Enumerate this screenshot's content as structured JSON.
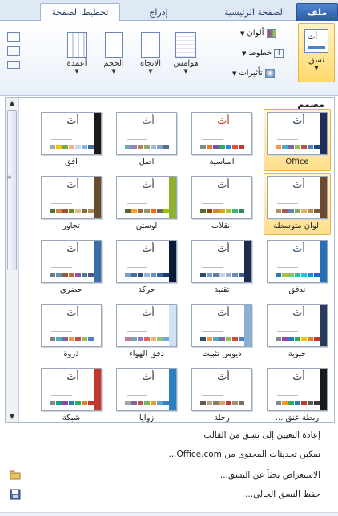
{
  "tabs": {
    "file": "ملف",
    "home": "الصفحة الرئيسية",
    "insert": "إدراج",
    "page_layout": "تخطيط الصفحة"
  },
  "ribbon": {
    "themes_label": "نسق",
    "colors_label": "ألوان",
    "fonts_label": "خطوط",
    "effects_label": "تأثيرات",
    "margins_label": "هوامش",
    "orientation_label": "الاتجاه",
    "size_label": "الحجم",
    "columns_label": "أعمدة"
  },
  "gallery": {
    "heading": "مصمم",
    "themes": [
      {
        "label": "Office",
        "accent": "#1f2f5a",
        "title_color": "#1f2f5a",
        "selected": true,
        "swatches": [
          "#1f497d",
          "#4f81bd",
          "#c0504d",
          "#9bbb59",
          "#8064a2",
          "#4bacc6",
          "#f79646"
        ]
      },
      {
        "label": "أساسية",
        "accent": "#ffffff",
        "title_color": "#c0392b",
        "selected": false,
        "swatches": [
          "#c0392b",
          "#e74c3c",
          "#2e86de",
          "#27ae60",
          "#8e44ad",
          "#e67e22",
          "#7f8c8d"
        ]
      },
      {
        "label": "أصل",
        "accent": "#ffffff",
        "title_color": "#555555",
        "selected": false,
        "swatches": [
          "#5b6c8f",
          "#7f9fcf",
          "#a0b8d8",
          "#8faa72",
          "#b48a5c",
          "#9c7fb8",
          "#6aa9b6"
        ]
      },
      {
        "label": "أفق",
        "accent": "#1a1a1a",
        "title_color": "#333333",
        "selected": false,
        "swatches": [
          "#3a6ea5",
          "#8fb0d6",
          "#c6d9ef",
          "#f4b183",
          "#70ad47",
          "#ffc000",
          "#a5a5a5"
        ]
      },
      {
        "label": "ألوان متوسطة",
        "accent": "#6b4a2f",
        "title_color": "#444444",
        "selected": true,
        "swatches": [
          "#7a5c3f",
          "#c08a4a",
          "#d9b36b",
          "#8aa65b",
          "#5f8aa6",
          "#a05a5a",
          "#b58d5f"
        ]
      },
      {
        "label": "انقلاب",
        "accent": "#ffffff",
        "title_color": "#444444",
        "selected": false,
        "swatches": [
          "#2e8b57",
          "#3cb371",
          "#9acd32",
          "#daa520",
          "#cd853f",
          "#8b4513",
          "#556b2f"
        ]
      },
      {
        "label": "أوستن",
        "accent": "#8fb030",
        "title_color": "#444444",
        "selected": false,
        "swatches": [
          "#94c600",
          "#71685a",
          "#ff6700",
          "#909465",
          "#956b43",
          "#fea022",
          "#4a6b2c"
        ]
      },
      {
        "label": "تجاور",
        "accent": "#6a4c2a",
        "title_color": "#444444",
        "selected": false,
        "swatches": [
          "#b08d57",
          "#8a6d3b",
          "#d9c089",
          "#6b8e23",
          "#a0522d",
          "#cd853f",
          "#556b2f"
        ]
      },
      {
        "label": "تدفق",
        "accent": "#2a6fb5",
        "title_color": "#1f4e79",
        "selected": false,
        "swatches": [
          "#0f6fc6",
          "#009dd9",
          "#0bd0d9",
          "#10cf9b",
          "#7cca62",
          "#a5c249",
          "#2e75b6"
        ]
      },
      {
        "label": "تقنية",
        "accent": "#1c2c4c",
        "title_color": "#333333",
        "selected": false,
        "swatches": [
          "#3f5f8a",
          "#6b8cb8",
          "#9ab0cf",
          "#c5d2e3",
          "#5a7fa6",
          "#7f9bbd",
          "#2e4a70"
        ]
      },
      {
        "label": "حركة",
        "accent": "#0b1a3a",
        "title_color": "#333333",
        "selected": false,
        "swatches": [
          "#1c3a6a",
          "#3766a5",
          "#6a8fc4",
          "#9bb4d8",
          "#2f4f7f",
          "#4d6f9f",
          "#7a9cc8"
        ]
      },
      {
        "label": "حضري",
        "accent": "#3a6ea5",
        "title_color": "#333333",
        "selected": false,
        "swatches": [
          "#53548a",
          "#438086",
          "#a04da3",
          "#c4652d",
          "#8b5d3d",
          "#5c92b5",
          "#6f7d8a"
        ]
      },
      {
        "label": "حيوية",
        "accent": "#2a3a5c",
        "title_color": "#444444",
        "selected": false,
        "swatches": [
          "#c0392b",
          "#e67e22",
          "#f1c40f",
          "#27ae60",
          "#2980b9",
          "#8e44ad",
          "#7f8c8d"
        ]
      },
      {
        "label": "ديوس تثبيت",
        "accent": "#8ab0d8",
        "title_color": "#444444",
        "selected": false,
        "swatches": [
          "#4f81bd",
          "#c0504d",
          "#9bbb59",
          "#8064a2",
          "#4bacc6",
          "#f79646",
          "#2c4d75"
        ]
      },
      {
        "label": "دفق الهواء",
        "accent": "#cfe3f5",
        "title_color": "#444444",
        "selected": false,
        "swatches": [
          "#6fa8dc",
          "#93c47d",
          "#f6b26b",
          "#e06666",
          "#8e7cc3",
          "#76a5af",
          "#c27ba0"
        ]
      },
      {
        "label": "ذروة",
        "accent": "#ffffff",
        "title_color": "#444444",
        "selected": false,
        "swatches": [
          "#4f81bd",
          "#9bbb59",
          "#c0504d",
          "#f79646",
          "#8064a2",
          "#4bacc6",
          "#7f7f7f"
        ]
      },
      {
        "label": "ربطة عنق ...",
        "accent": "#1a1a1a",
        "title_color": "#333333",
        "selected": false,
        "swatches": [
          "#3a3a3a",
          "#5a5a5a",
          "#c0392b",
          "#2980b9",
          "#27ae60",
          "#f39c12",
          "#7f8c8d"
        ]
      },
      {
        "label": "رحلة",
        "accent": "#ffffff",
        "title_color": "#333333",
        "selected": false,
        "swatches": [
          "#7f6f5f",
          "#a58f6f",
          "#c0392b",
          "#d4a373",
          "#8c7a6b",
          "#b5a48b",
          "#6b5b4b"
        ]
      },
      {
        "label": "زوايا",
        "accent": "#2a7fc0",
        "title_color": "#333333",
        "selected": false,
        "swatches": [
          "#3a7fc0",
          "#5ba3d9",
          "#f29a2e",
          "#7bb661",
          "#c0504d",
          "#8064a2",
          "#a5a5a5"
        ]
      },
      {
        "label": "شبكة",
        "accent": "#c0392b",
        "title_color": "#333333",
        "selected": false,
        "swatches": [
          "#c0392b",
          "#e67e22",
          "#27ae60",
          "#2980b9",
          "#8e44ad",
          "#16a085",
          "#7f8c8d"
        ]
      }
    ]
  },
  "menu": {
    "items": [
      {
        "label": "إعادة التعيين إلى نسق من القالب",
        "icon": "none",
        "enabled": true
      },
      {
        "label": "تمكين تحديثات المحتوى من Office.com...",
        "icon": "none",
        "enabled": true
      },
      {
        "label": "الاستعراض بحثاً عن النسق...",
        "icon": "folder-icon",
        "enabled": true
      },
      {
        "label": "حفظ النسق الحالي...",
        "icon": "save-icon",
        "enabled": true
      }
    ]
  }
}
